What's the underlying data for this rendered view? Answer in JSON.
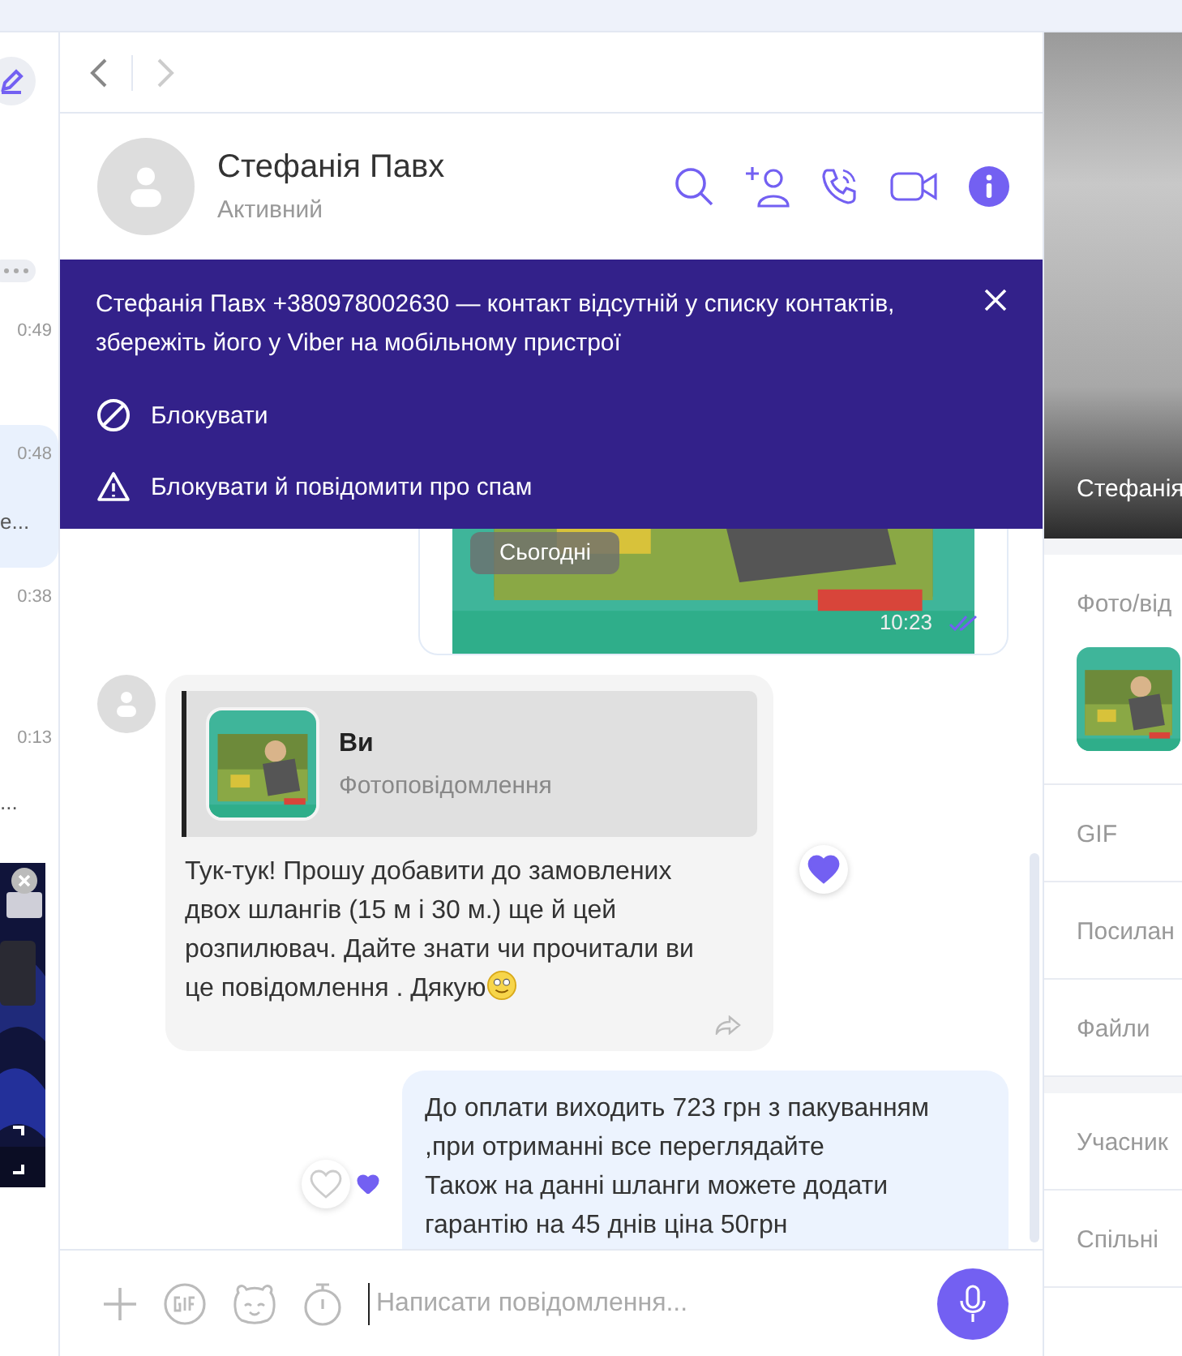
{
  "sidebar": {
    "items": [
      {
        "time": "0:49",
        "selected": false
      },
      {
        "time": "0:48",
        "preview": "e...",
        "selected": true
      },
      {
        "time": "0:38",
        "selected": false
      },
      {
        "time": "0:13",
        "preview": "...",
        "selected": false
      }
    ]
  },
  "chat": {
    "name": "Стефанія Павх",
    "status": "Активний"
  },
  "banner": {
    "text": "Стефанія Павх +380978002630 — контакт відсутній у списку контактів, збережіть його у Viber на мобільному пристрої",
    "actions": [
      {
        "kind": "block",
        "label": "Блокувати"
      },
      {
        "kind": "report",
        "label": "Блокувати й повідомити про спам"
      }
    ]
  },
  "date_divider": "Сьогодні",
  "messages": [
    {
      "time": "10:23",
      "read": true
    },
    {
      "kind": "incoming",
      "quote": {
        "author": "Ви",
        "type": "Фотоповідомлення"
      },
      "text": "Тук-тук! Прошу добавити до замовлених двох шлангів (15 м і 30 м.) ще й цей розпилювач. Дайте знати чи прочитали ви це повідомлення . Дякую",
      "reaction": true
    },
    {
      "kind": "outgoing",
      "text": "До оплати виходить 723 грн з пакуванням ,при отриманні все переглядайте\nТакож на данні шланги можете додати гарантію на 45 днів ціна 50грн",
      "reaction": true
    }
  ],
  "composer": {
    "placeholder": "Написати повідомлення..."
  },
  "info_panel": {
    "name": "Стефанія",
    "section_groups": [
      [
        {
          "kind": "media",
          "title": "Фото/від"
        },
        {
          "kind": "plain",
          "title": "GIF"
        },
        {
          "kind": "plain",
          "title": "Посилан"
        },
        {
          "kind": "plain",
          "title": "Файли"
        }
      ],
      [
        {
          "kind": "plain",
          "title": "Учасник"
        },
        {
          "kind": "plain",
          "title": "Спільні"
        }
      ]
    ]
  }
}
